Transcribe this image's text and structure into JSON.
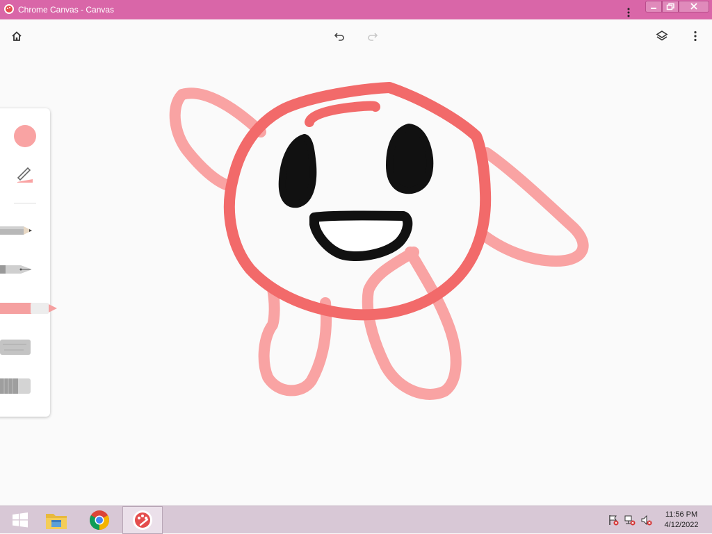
{
  "window": {
    "title": "Chrome Canvas - Canvas",
    "app_icon": "chrome-canvas-icon",
    "menu_icon": "vertical-dots-icon",
    "controls": [
      "minimize-icon",
      "restore-icon",
      "close-icon"
    ],
    "title_bar_color": "#d966a8"
  },
  "toolbar": {
    "left": [
      "home-icon"
    ],
    "center": [
      "undo-icon",
      "redo-icon"
    ],
    "right": [
      "layers-icon",
      "more-vert-icon"
    ]
  },
  "tools": {
    "selected_color": "#f9a3a3",
    "items": [
      {
        "name": "color-swatch-icon"
      },
      {
        "name": "stroke-size-icon"
      },
      {
        "name": "pencil-icon"
      },
      {
        "name": "pen-icon"
      },
      {
        "name": "marker-icon",
        "selected": true
      },
      {
        "name": "chalk-icon"
      },
      {
        "name": "eraser-icon"
      }
    ]
  },
  "colors": {
    "marker_light": "#f9a3a3",
    "marker_dark": "#f26a6a",
    "ink": "#111111"
  },
  "taskbar": {
    "items": [
      "windows-start-icon",
      "file-explorer-icon",
      "chrome-icon",
      "canvas-app-icon"
    ],
    "tray": [
      "flag-alert-icon",
      "network-icon",
      "speaker-muted-icon"
    ],
    "time": "11:56 PM",
    "date": "4/12/2022"
  }
}
